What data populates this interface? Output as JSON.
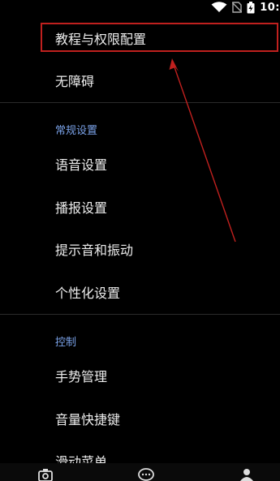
{
  "status_bar": {
    "time": "10:",
    "icons": [
      "wifi-icon",
      "no-sim-icon",
      "battery-charging-icon"
    ]
  },
  "menu": {
    "tutorial_permissions": "教程与权限配置",
    "accessibility": "无障碍"
  },
  "general_section": {
    "title": "常规设置",
    "items": [
      "语音设置",
      "播报设置",
      "提示音和振动",
      "个性化设置"
    ]
  },
  "control_section": {
    "title": "控制",
    "items": [
      "手势管理",
      "音量快捷键",
      "滑动菜单"
    ]
  },
  "bottom_nav": {
    "icons": [
      "camera-icon",
      "chat-icon",
      "profile-icon"
    ]
  },
  "colors": {
    "background": "#000000",
    "section_title": "#7aa2e8",
    "highlight": "#c0201e"
  }
}
